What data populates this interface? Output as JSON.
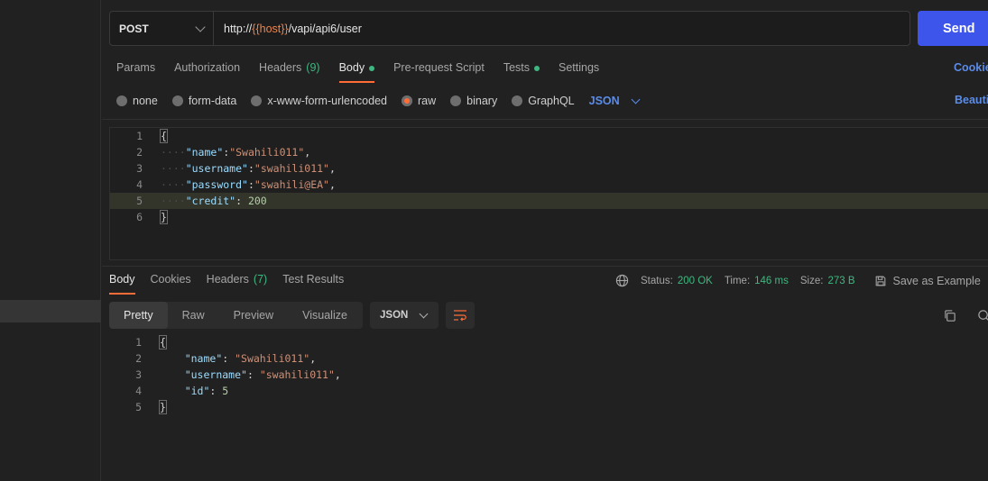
{
  "request": {
    "method": "POST",
    "url_prefix": "http://",
    "url_var": "{{host}}",
    "url_path": "/vapi/api6/user",
    "send_label": "Send"
  },
  "request_tabs": [
    {
      "label": "Params"
    },
    {
      "label": "Authorization"
    },
    {
      "label": "Headers",
      "count": "(9)"
    },
    {
      "label": "Body",
      "active": true,
      "dot": true
    },
    {
      "label": "Pre-request Script"
    },
    {
      "label": "Tests",
      "dot": true
    },
    {
      "label": "Settings"
    }
  ],
  "cookies_link": "Cookie",
  "body_types": [
    "none",
    "form-data",
    "x-www-form-urlencoded",
    "raw",
    "binary",
    "GraphQL"
  ],
  "body_type_selected": "raw",
  "body_format": "JSON",
  "beautify_link": "Beauti",
  "request_body": [
    {
      "ln": "1",
      "text": "{"
    },
    {
      "ln": "2",
      "key": "\"name\"",
      "sep": ":",
      "value": "\"Swahili011\"",
      "trail": ","
    },
    {
      "ln": "3",
      "key": "\"username\"",
      "sep": ":",
      "value": "\"swahili011\"",
      "trail": ","
    },
    {
      "ln": "4",
      "key": "\"password\"",
      "sep": ":",
      "value": "\"swahili@EA\"",
      "trail": ","
    },
    {
      "ln": "5",
      "key": "\"credit\"",
      "sep": ": ",
      "value": "200",
      "trail": ""
    },
    {
      "ln": "6",
      "text": "}"
    }
  ],
  "response_tabs": [
    {
      "label": "Body",
      "active": true
    },
    {
      "label": "Cookies"
    },
    {
      "label": "Headers",
      "count": "(7)"
    },
    {
      "label": "Test Results"
    }
  ],
  "response_meta": {
    "status_label": "Status:",
    "status_value": "200 OK",
    "time_label": "Time:",
    "time_value": "146 ms",
    "size_label": "Size:",
    "size_value": "273 B",
    "save_example": "Save as Example"
  },
  "view_tabs": [
    "Pretty",
    "Raw",
    "Preview",
    "Visualize"
  ],
  "view_tab_active": "Pretty",
  "response_format": "JSON",
  "response_body": [
    {
      "ln": "1",
      "text": "{"
    },
    {
      "ln": "2",
      "key": "\"name\"",
      "sep": ": ",
      "value": "\"Swahili011\"",
      "trail": ","
    },
    {
      "ln": "3",
      "key": "\"username\"",
      "sep": ": ",
      "value": "\"swahili011\"",
      "trail": ","
    },
    {
      "ln": "4",
      "key": "\"id\"",
      "sep": ": ",
      "value": "5",
      "trail": ""
    },
    {
      "ln": "5",
      "text": "}"
    }
  ],
  "colors": {
    "accent": "#ff6c37",
    "send": "#3e55ec",
    "success": "#3fb780",
    "link": "#5a8cea"
  }
}
